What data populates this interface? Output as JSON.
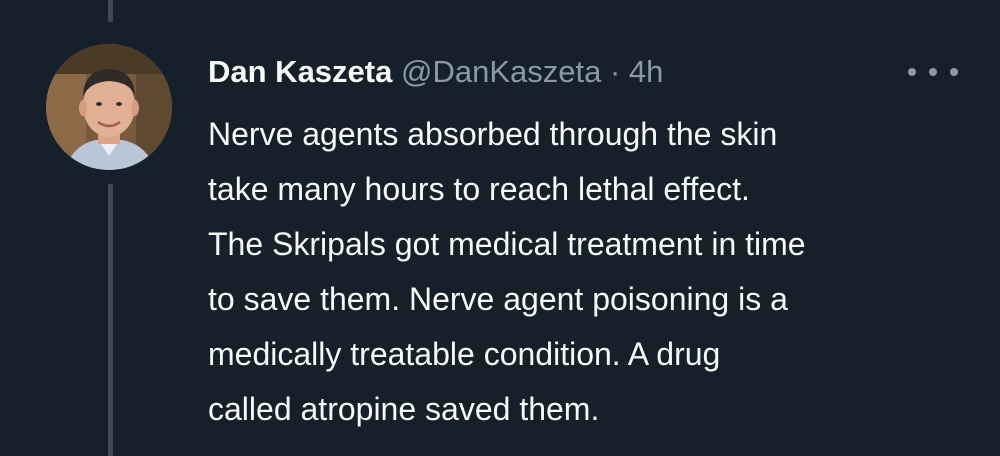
{
  "author": {
    "display_name": "Dan Kaszeta",
    "handle": "@DanKaszeta",
    "separator": "·",
    "timestamp": "4h",
    "avatar_icon": "user-avatar"
  },
  "tweet": {
    "text_lines": [
      "Nerve agents absorbed through the skin",
      "take many hours to reach lethal effect.",
      "The Skripals got medical treatment in time",
      "to save them. Nerve agent poisoning is a",
      "medically treatable condition. A drug",
      "called atropine saved them."
    ]
  },
  "actions": {
    "more_icon": "more-options-icon"
  },
  "colors": {
    "background": "#15202b",
    "primary_text": "#f7f9f9",
    "secondary_text": "#8b98a5",
    "thread_line": "#3d4a57"
  }
}
